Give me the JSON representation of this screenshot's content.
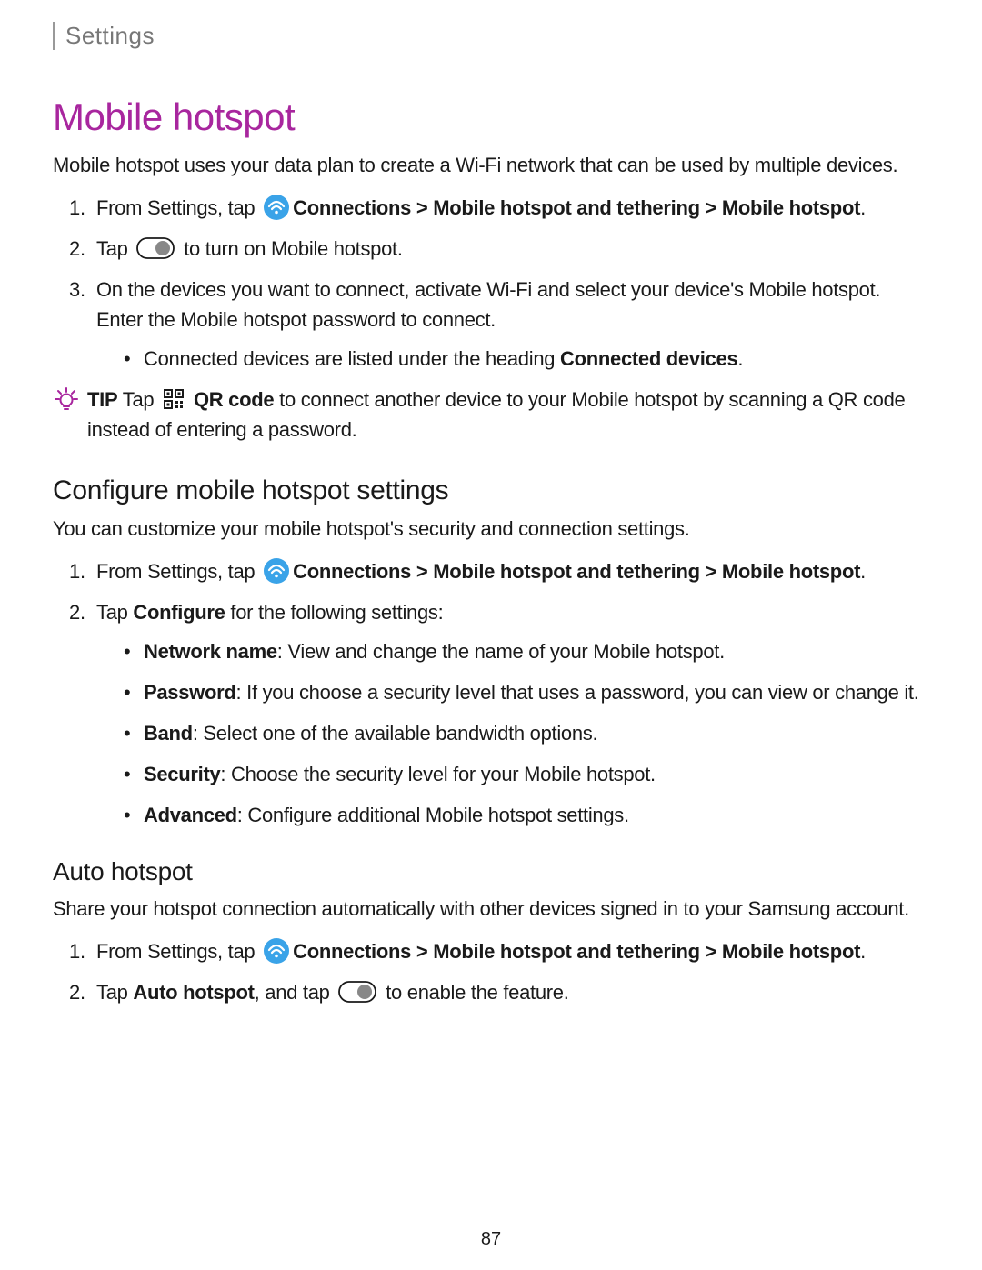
{
  "breadcrumb": "Settings",
  "title": "Mobile hotspot",
  "intro": "Mobile hotspot uses your data plan to create a Wi-Fi network that can be used by multiple devices.",
  "steps1": {
    "s1_prefix": "From Settings, tap ",
    "s1_bold": "Connections > Mobile hotspot and tethering > Mobile hotspot",
    "s1_suffix": ".",
    "s2_prefix": "Tap ",
    "s2_suffix": " to turn on Mobile hotspot.",
    "s3": "On the devices you want to connect, activate Wi-Fi and select your device's Mobile hotspot. Enter the Mobile hotspot password to connect.",
    "s3_sub_prefix": "Connected devices are listed under the heading ",
    "s3_sub_bold": "Connected devices",
    "s3_sub_suffix": "."
  },
  "tip": {
    "label": "TIP",
    "prefix": "  Tap ",
    "bold": " QR code",
    "suffix": " to connect another device to your Mobile hotspot by scanning a QR code instead of entering a password."
  },
  "section2": {
    "heading": "Configure mobile hotspot settings",
    "intro": "You can customize your mobile hotspot's security and connection settings.",
    "s1_prefix": "From Settings, tap ",
    "s1_bold": "Connections > Mobile hotspot and tethering > Mobile hotspot",
    "s1_suffix": ".",
    "s2_prefix": "Tap ",
    "s2_bold": "Configure",
    "s2_suffix": " for the following settings:",
    "bullets": {
      "b1_bold": "Network name",
      "b1_text": ": View and change the name of your Mobile hotspot.",
      "b2_bold": "Password",
      "b2_text": ": If you choose a security level that uses a password, you can view or change it.",
      "b3_bold": "Band",
      "b3_text": ": Select one of the available bandwidth options.",
      "b4_bold": "Security",
      "b4_text": ": Choose the security level for your Mobile hotspot.",
      "b5_bold": "Advanced",
      "b5_text": ": Configure additional Mobile hotspot settings."
    }
  },
  "section3": {
    "heading": "Auto hotspot",
    "intro": "Share your hotspot connection automatically with other devices signed in to your Samsung account.",
    "s1_prefix": "From Settings, tap ",
    "s1_bold": "Connections > Mobile hotspot and tethering > Mobile hotspot",
    "s1_suffix": ".",
    "s2_prefix": "Tap ",
    "s2_bold": "Auto hotspot",
    "s2_mid": ", and tap ",
    "s2_suffix": " to enable the feature."
  },
  "page": "87"
}
